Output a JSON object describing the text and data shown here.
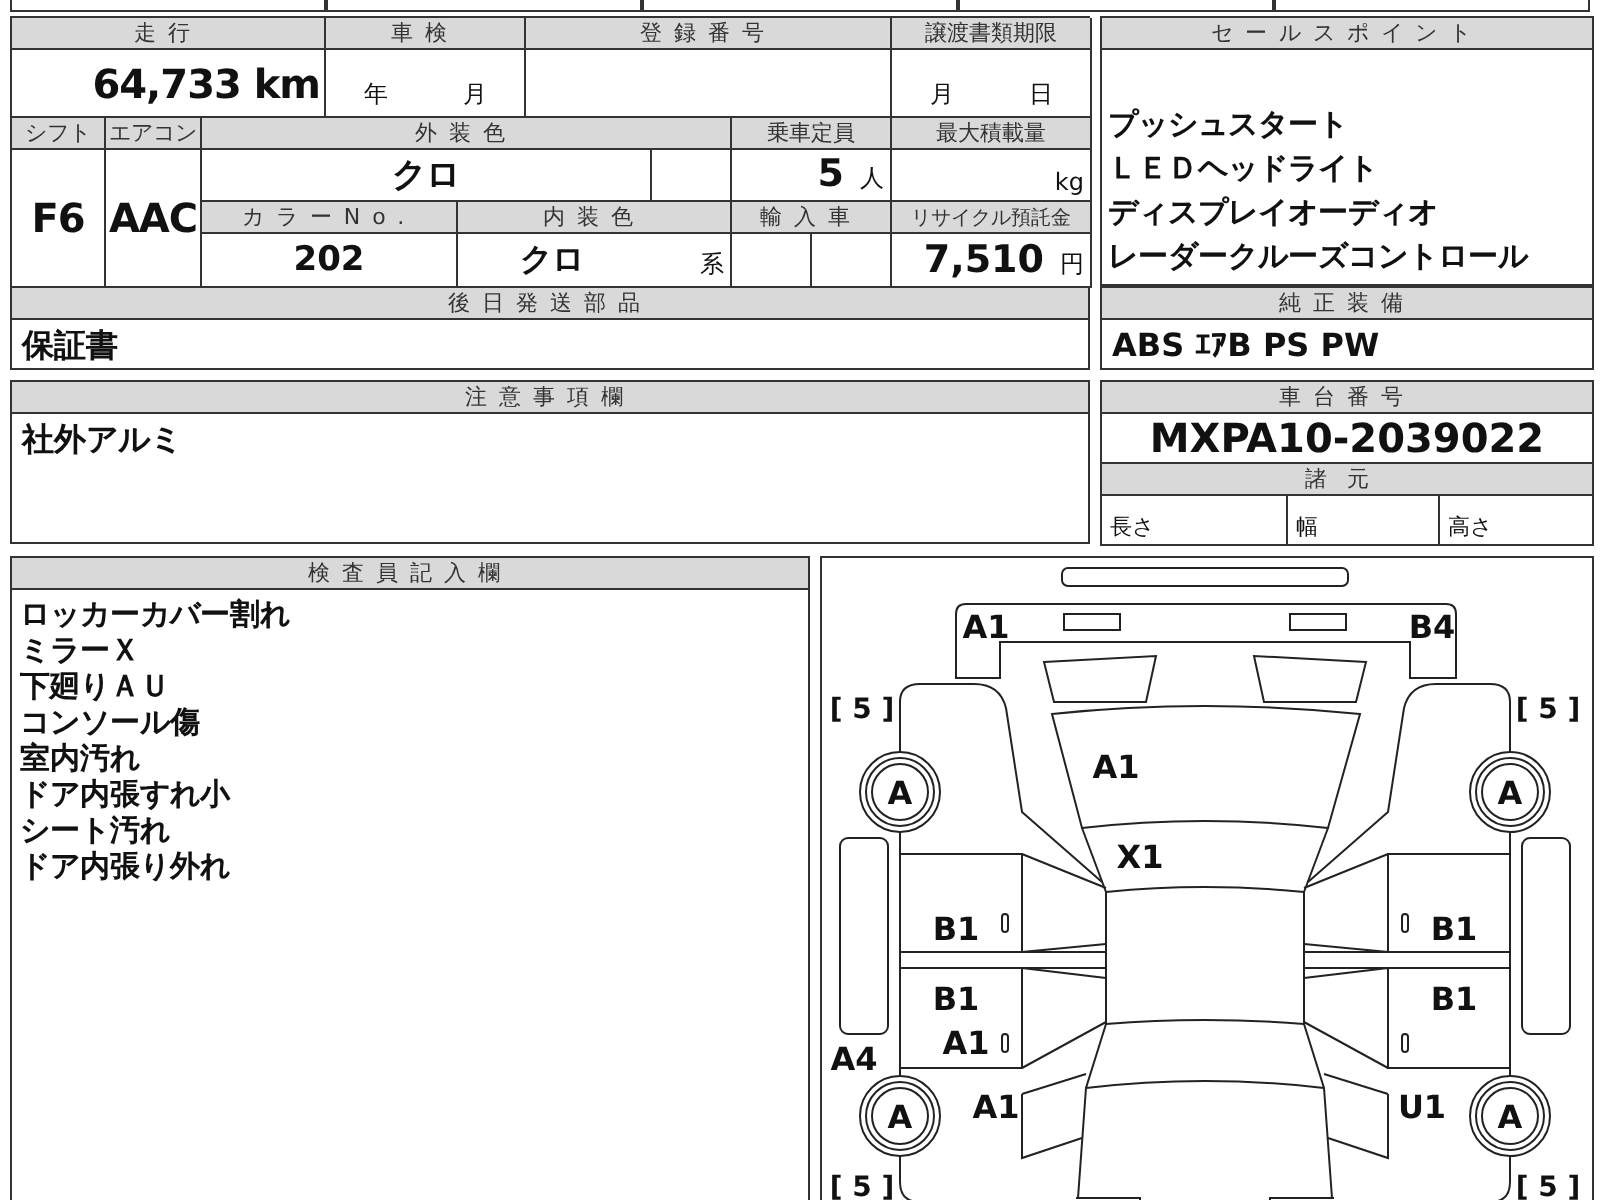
{
  "odometer": {
    "label": "走行",
    "value": "64,733 km"
  },
  "inspection": {
    "label": "車検",
    "year_unit": "年",
    "month_unit": "月"
  },
  "registration": {
    "label": "登録番号"
  },
  "transfer_deadline": {
    "label": "譲渡書類期限",
    "month_unit": "月",
    "day_unit": "日"
  },
  "shift": {
    "label": "シフト",
    "value": "F6"
  },
  "aircon": {
    "label": "エアコン",
    "value": "AAC"
  },
  "exterior_color": {
    "label": "外装色",
    "value": "クロ"
  },
  "capacity": {
    "label": "乗車定員",
    "value": "5",
    "unit": "人"
  },
  "max_load": {
    "label": "最大積載量",
    "unit": "kg"
  },
  "color_no": {
    "label": "カラーNo.",
    "value": "202"
  },
  "interior_color": {
    "label": "内装色",
    "value": "クロ",
    "suffix": "系"
  },
  "imported": {
    "label": "輸入車"
  },
  "recycle_fee": {
    "label": "リサイクル預託金",
    "value": "7,510",
    "unit": "円"
  },
  "sale_points": {
    "label": "セールスポイント",
    "items": [
      "プッシュスタート",
      "ＬＥＤヘッドライト",
      "ディスプレイオーディオ",
      "レーダークルーズコントロール"
    ]
  },
  "later_parts": {
    "label": "後日発送部品",
    "value": "保証書"
  },
  "standard_equipment": {
    "label": "純正装備",
    "value": "ABS ｴｱB PS PW"
  },
  "notes": {
    "label": "注意事項欄",
    "value": "社外アルミ"
  },
  "chassis_number": {
    "label": "車台番号",
    "value": "MXPA10-2039022"
  },
  "specs": {
    "label": "諸元",
    "items": [
      "長さ",
      "幅",
      "高さ"
    ]
  },
  "inspector_notes": {
    "label": "検査員記入欄",
    "lines": [
      "ロッカーカバー割れ",
      "ミラーＸ",
      "下廻りＡＵ",
      "コンソール傷",
      "室内汚れ",
      "ドア内張すれ小",
      "シート汚れ",
      "ドア内張り外れ"
    ]
  },
  "diagram": {
    "marks": [
      "A1",
      "B4",
      "A1",
      "X1",
      "B1",
      "B1",
      "B1",
      "B1",
      "A4",
      "A1",
      "A1",
      "U1"
    ],
    "tires": [
      "A",
      "A",
      "A",
      "A"
    ],
    "tread": [
      "[ 5 ]",
      "[ 5 ]",
      "[ 5 ]",
      "[ 5 ]"
    ]
  }
}
